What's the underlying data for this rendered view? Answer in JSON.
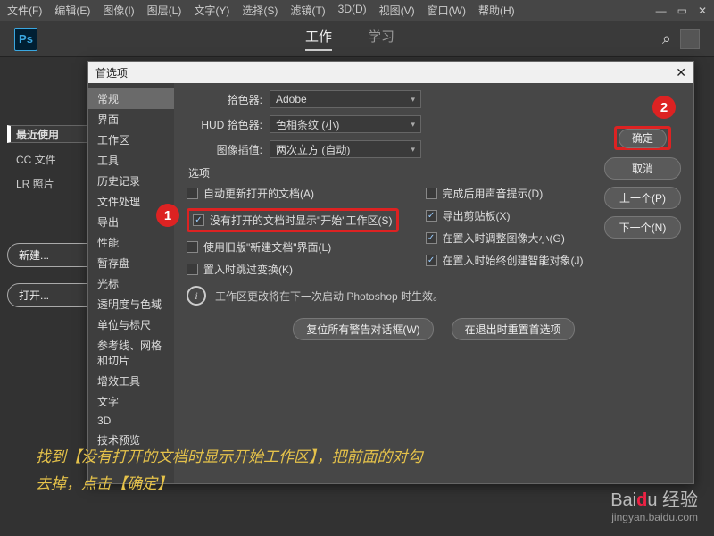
{
  "menubar": {
    "items": [
      "文件(F)",
      "编辑(E)",
      "图像(I)",
      "图层(L)",
      "文字(Y)",
      "选择(S)",
      "滤镜(T)",
      "3D(D)",
      "视图(V)",
      "窗口(W)",
      "帮助(H)"
    ]
  },
  "logo": "Ps",
  "tabs": {
    "work": "工作",
    "learn": "学习"
  },
  "leftnav": {
    "recent": "最近使用",
    "cc": "CC 文件",
    "lr": "LR 照片",
    "new": "新建...",
    "open": "打开..."
  },
  "dialog": {
    "title": "首选项",
    "cats": [
      "常规",
      "界面",
      "工作区",
      "工具",
      "历史记录",
      "文件处理",
      "导出",
      "性能",
      "暂存盘",
      "光标",
      "透明度与色域",
      "单位与标尺",
      "参考线、网格和切片",
      "增效工具",
      "文字",
      "3D",
      "技术预览"
    ],
    "pickerLabel": "拾色器:",
    "pickerVal": "Adobe",
    "hudLabel": "HUD 拾色器:",
    "hudVal": "色相条纹 (小)",
    "interpLabel": "图像插值:",
    "interpVal": "两次立方 (自动)",
    "optionsTitle": "选项",
    "left": [
      {
        "t": "自动更新打开的文档(A)",
        "on": false
      },
      {
        "t": "没有打开的文档时显示\"开始\"工作区(S)",
        "on": true,
        "hl": true
      },
      {
        "t": "使用旧版\"新建文档\"界面(L)",
        "on": false
      },
      {
        "t": "置入时跳过变换(K)",
        "on": false
      }
    ],
    "right": [
      {
        "t": "完成后用声音提示(D)",
        "on": false
      },
      {
        "t": "导出剪贴板(X)",
        "on": true
      },
      {
        "t": "在置入时调整图像大小(G)",
        "on": true
      },
      {
        "t": "在置入时始终创建智能对象(J)",
        "on": true
      }
    ],
    "info": "工作区更改将在下一次启动 Photoshop 时生效。",
    "resetWarn": "复位所有警告对话框(W)",
    "resetExit": "在退出时重置首选项",
    "ok": "确定",
    "cancel": "取消",
    "prev": "上一个(P)",
    "next": "下一个(N)"
  },
  "badges": {
    "b1": "1",
    "b2": "2"
  },
  "annotation": {
    "l1": "找到【没有打开的文档时显示开始工作区】，把前面的对勾",
    "l2": "去掉，点击【确定】"
  },
  "brand": {
    "logo": "Baidu 经验",
    "url": "jingyan.baidu.com"
  }
}
